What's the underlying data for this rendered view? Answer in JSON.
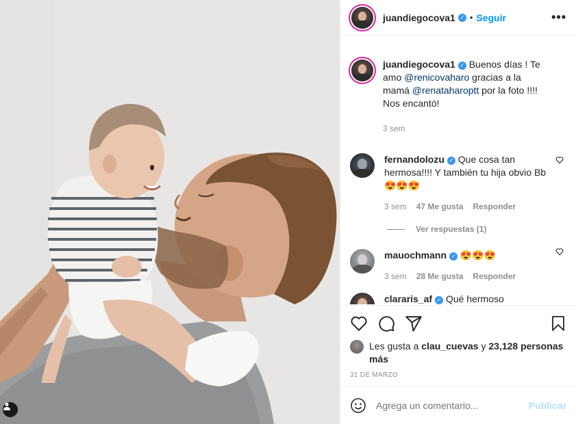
{
  "post": {
    "author": "juandiegocova1",
    "follow_label": "Seguir",
    "dot": "•",
    "more_label": "•••",
    "caption": {
      "text_before": "Buenos días ! Te amo ",
      "mention1": "@renicovaharo",
      "text_middle": " gracias a la mamá ",
      "mention2": "@renataharoptt",
      "text_after": " por la foto !!!! Nos encantó!",
      "time": "3 sem"
    },
    "comments": [
      {
        "user": "fernandolozu",
        "text": "Que cosa tan hermosa!!!! Y también tu hija obvio Bb 😍😍😍",
        "time": "3 sem",
        "likes": "47 Me gusta",
        "reply_label": "Responder",
        "view_replies": "Ver respuestas (1)"
      },
      {
        "user": "mauochmann",
        "text": "😍😍😍",
        "time": "3 sem",
        "likes": "28 Me gusta",
        "reply_label": "Responder"
      },
      {
        "user": "clararis_af",
        "text": "Qué hermoso"
      }
    ],
    "liked_by": {
      "prefix": "Les gusta a ",
      "user": "clau_cuevas",
      "middle": " y ",
      "count": "23,128 personas más"
    },
    "date": "31 DE MARZO",
    "add_comment_placeholder": "Agrega un comentario...",
    "publish_label": "Publicar"
  },
  "icons": {
    "verified": "verified-badge-icon",
    "heart": "heart-icon",
    "comment": "comment-icon",
    "share": "share-icon",
    "bookmark": "bookmark-icon",
    "emoji": "emoji-icon",
    "tag_user": "user-tag-icon"
  },
  "colors": {
    "accent": "#0095f6",
    "publish_disabled": "#b2dffc",
    "mention": "#00376b",
    "muted": "#8e8e8e"
  }
}
